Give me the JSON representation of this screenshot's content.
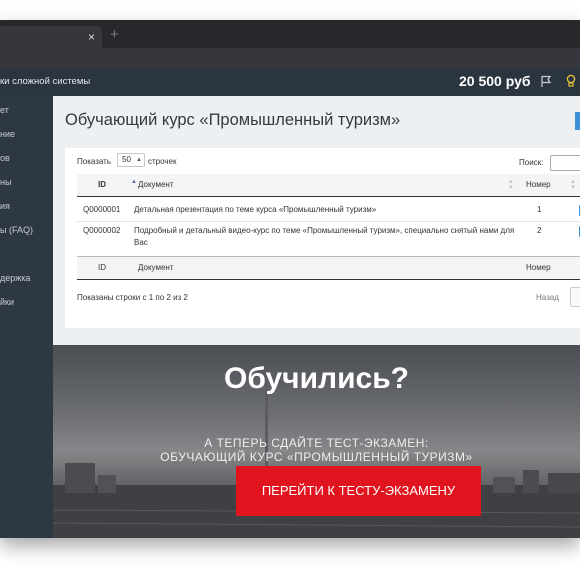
{
  "browser": {
    "tab_close": "×",
    "new_tab": "+"
  },
  "header": {
    "app_title": "ки сложной системы",
    "balance": "20 500 руб"
  },
  "sidebar": {
    "items": [
      {
        "label": "ет"
      },
      {
        "label": "ние"
      },
      {
        "label": "ов"
      },
      {
        "label": "ны"
      },
      {
        "label": "ия"
      },
      {
        "label": "ы (FAQ)"
      },
      {
        "label": "держка"
      },
      {
        "label": "йки"
      }
    ]
  },
  "main": {
    "title": "Обучающий курс «Промышленный туризм»"
  },
  "table": {
    "show_label": "Показать",
    "page_size": "50",
    "rows_label": "строчек",
    "search_label": "Поиск:",
    "columns": [
      "ID",
      "Документ",
      "Номер"
    ],
    "rows": [
      {
        "id": "Q0000001",
        "doc": "Детальная презентация по теме курса «Промышленный туризм»",
        "num": "1"
      },
      {
        "id": "Q0000002",
        "doc": "Подробный и детальный видео-курс по теме «Промышленный туризм», специально снятый нами для Вас",
        "num": "2"
      }
    ],
    "info": "Показаны строки с 1 по 2 из 2",
    "prev": "Назад"
  },
  "hero": {
    "title": "Обучились?",
    "subtitle_line1": "А ТЕПЕРЬ СДАЙТЕ ТЕСТ-ЭКЗАМЕН:",
    "subtitle_line2": "ОБУЧАЮЩИЙ КУРС «ПРОМЫШЛЕННЫЙ ТУРИЗМ»",
    "cta": "ПЕРЕЙТИ К ТЕСТУ-ЭКЗАМЕНУ"
  },
  "colors": {
    "header_bg": "#2b3540",
    "sidebar_bg": "#2e3843",
    "accent_blue": "#3a8fd6",
    "cta_red": "#e0141e"
  },
  "icons": [
    "close-icon",
    "plus-icon",
    "flag-icon",
    "lightbulb-icon",
    "sort-asc-icon",
    "sort-icon",
    "select-arrow-icon"
  ]
}
